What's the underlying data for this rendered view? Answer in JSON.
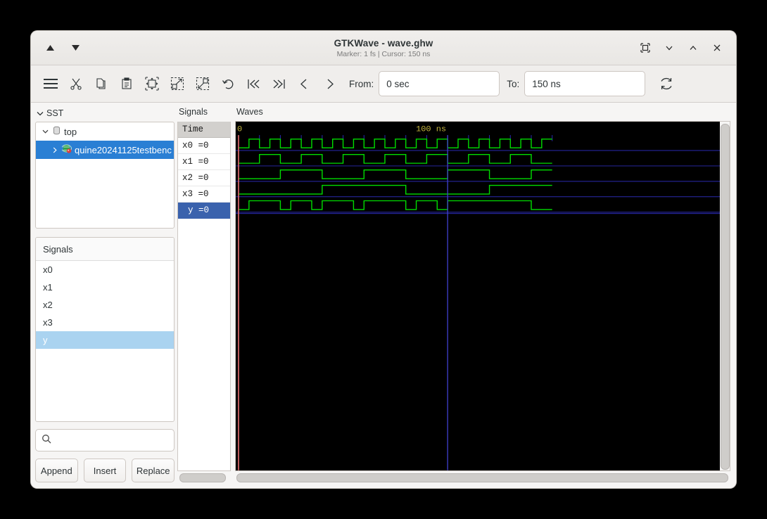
{
  "window": {
    "title": "GTKWave - wave.ghw",
    "subtitle": "Marker: 1 fs  |  Cursor: 150 ns",
    "nav_up_icon": "triangle-up-icon",
    "nav_down_icon": "triangle-down-icon",
    "restore_icon": "restore-icon",
    "minimize_icon": "minimize-icon",
    "maximize_icon": "maximize-icon",
    "close_icon": "close-icon"
  },
  "toolbar": {
    "icons": [
      "menu-icon",
      "cut-icon",
      "copy-icon",
      "paste-icon",
      "zoom-fit-icon",
      "zoom-in-icon",
      "zoom-out-icon",
      "undo-icon",
      "go-first-icon",
      "go-last-icon",
      "go-prev-icon",
      "go-next-icon"
    ],
    "from_label": "From:",
    "from_value": "0 sec",
    "to_label": "To:",
    "to_value": "150 ns",
    "reload_icon": "reload-icon"
  },
  "sst": {
    "header": "SST",
    "header_chevron": "chevron-down-icon",
    "tree": [
      {
        "label": "top",
        "icon": "module-icon",
        "chevron": "chevron-down-icon",
        "selected": false,
        "depth": 0
      },
      {
        "label": "quine20241125testbenc",
        "icon": "instance-icon",
        "chevron": "chevron-right-icon",
        "selected": true,
        "depth": 1
      }
    ]
  },
  "signal_picker": {
    "header": "Signals",
    "items": [
      {
        "label": "x0",
        "selected": false
      },
      {
        "label": "x1",
        "selected": false
      },
      {
        "label": "x2",
        "selected": false
      },
      {
        "label": "x3",
        "selected": false
      },
      {
        "label": "y",
        "selected": true
      }
    ],
    "search_placeholder": "",
    "search_value": "",
    "search_icon": "search-icon",
    "buttons": [
      {
        "label": "Append"
      },
      {
        "label": "Insert"
      },
      {
        "label": "Replace"
      }
    ]
  },
  "wave_panel": {
    "names_header": "Signals",
    "waves_header": "Waves",
    "time_row_label": "Time",
    "rows": [
      {
        "label": "x0 =0",
        "selected": false
      },
      {
        "label": "x1 =0",
        "selected": false
      },
      {
        "label": "x2 =0",
        "selected": false
      },
      {
        "label": "x3 =0",
        "selected": false
      },
      {
        "label": " y =0",
        "selected": true
      }
    ]
  },
  "chart_data": {
    "type": "line",
    "title": "GTKWave digital waveform viewer",
    "xlabel": "time",
    "xlim": [
      0,
      150
    ],
    "x_visible_range": [
      0,
      150
    ],
    "time_unit": "ns",
    "tick_interval_ns": 10,
    "tick_labels": [
      {
        "time_ns": 0,
        "text": "0"
      },
      {
        "time_ns": 100,
        "text": "100 ns"
      }
    ],
    "marker_time": "1 fs",
    "marker_time_ns": 0,
    "cursor_time": "150 ns",
    "cursor_time_ns": 100,
    "colors": {
      "background": "#000000",
      "trace": "#00dd00",
      "grid": "#2a2ab0",
      "cursor": "#4040d0",
      "marker": "#e87070",
      "time_text": "#c8b840"
    },
    "waveform_end_ns": 150,
    "series": [
      {
        "name": "x0",
        "value": 0,
        "period_ns": 10,
        "first_edge_ns": 5,
        "initial": 0,
        "edges_ns": [
          5,
          10,
          15,
          20,
          25,
          30,
          35,
          40,
          45,
          50,
          55,
          60,
          65,
          70,
          75,
          80,
          85,
          90,
          95,
          100,
          105,
          110,
          115,
          120,
          125,
          130,
          135,
          140,
          145
        ]
      },
      {
        "name": "x1",
        "value": 0,
        "period_ns": 20,
        "first_edge_ns": 10,
        "initial": 0,
        "edges_ns": [
          10,
          20,
          30,
          40,
          50,
          60,
          70,
          80,
          90,
          100,
          110,
          120,
          130,
          140
        ]
      },
      {
        "name": "x2",
        "value": 0,
        "period_ns": 40,
        "first_edge_ns": 20,
        "initial": 0,
        "edges_ns": [
          20,
          40,
          60,
          80,
          100,
          120,
          140
        ]
      },
      {
        "name": "x3",
        "value": 0,
        "period_ns": 80,
        "first_edge_ns": 40,
        "initial": 0,
        "edges_ns": [
          40,
          80,
          120
        ]
      },
      {
        "name": "y",
        "value": 0,
        "initial": 0,
        "edges_ns": [
          5,
          20,
          25,
          35,
          40,
          55,
          60,
          80,
          85,
          95,
          100,
          140
        ]
      }
    ]
  }
}
